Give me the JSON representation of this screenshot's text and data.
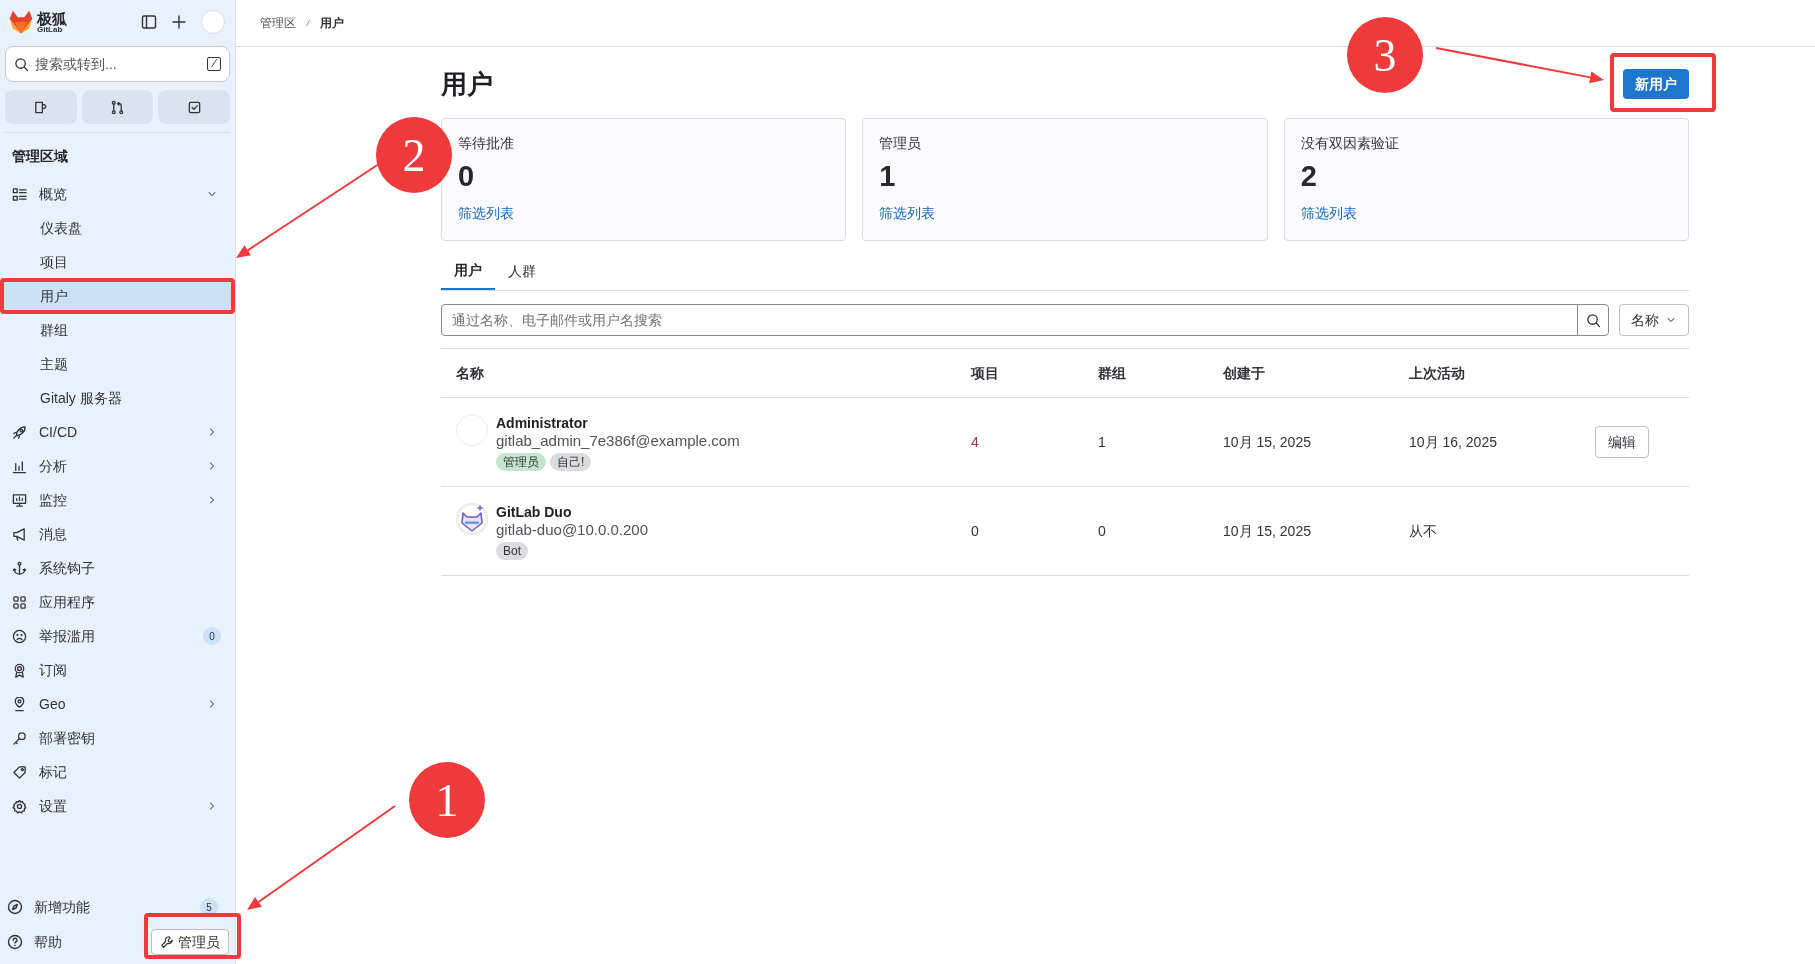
{
  "sidebar": {
    "logo_text": "极狐",
    "logo_sub": "GitLab",
    "search_placeholder": "搜索或转到...",
    "search_shortcut": "/",
    "section_title": "管理区域",
    "items": [
      {
        "label": "概览",
        "selected": false,
        "expanded": true,
        "children": [
          {
            "label": "仪表盘",
            "selected": false
          },
          {
            "label": "项目",
            "selected": false
          },
          {
            "label": "用户",
            "selected": true
          },
          {
            "label": "群组",
            "selected": false
          },
          {
            "label": "主题",
            "selected": false
          },
          {
            "label": "Gitaly 服务器",
            "selected": false
          }
        ]
      },
      {
        "label": "CI/CD",
        "selected": false,
        "expanded": false
      },
      {
        "label": "分析",
        "selected": false,
        "expanded": false
      },
      {
        "label": "监控",
        "selected": false,
        "expanded": false
      },
      {
        "label": "消息",
        "selected": false
      },
      {
        "label": "系统钩子",
        "selected": false
      },
      {
        "label": "应用程序",
        "selected": false
      },
      {
        "label": "举报滥用",
        "selected": false,
        "badge": "0"
      },
      {
        "label": "订阅",
        "selected": false
      },
      {
        "label": "Geo",
        "selected": false,
        "expanded": false
      },
      {
        "label": "部署密钥",
        "selected": false
      },
      {
        "label": "标记",
        "selected": false
      },
      {
        "label": "设置",
        "selected": false,
        "expanded": false
      }
    ],
    "whats_new": {
      "label": "新增功能",
      "badge": "5"
    },
    "help": "帮助",
    "admin_button": "管理员"
  },
  "breadcrumb": [
    "管理区",
    "用户"
  ],
  "page_title": "用户",
  "new_user_button": "新用户",
  "stats": [
    {
      "label": "等待批准",
      "value": "0",
      "link": "筛选列表"
    },
    {
      "label": "管理员",
      "value": "1",
      "link": "筛选列表"
    },
    {
      "label": "没有双因素验证",
      "value": "2",
      "link": "筛选列表"
    }
  ],
  "tabs": [
    {
      "label": "用户",
      "selected": true
    },
    {
      "label": "人群",
      "selected": false
    }
  ],
  "search": {
    "placeholder": "通过名称、电子邮件或用户名搜索"
  },
  "sort": "名称",
  "table": {
    "columns": [
      "名称",
      "项目",
      "群组",
      "创建于",
      "上次活动"
    ],
    "rows": [
      {
        "kind": "human",
        "name": "Administrator",
        "email": "gitlab_admin_7e386f@example.com",
        "tags": [
          {
            "label": "管理员",
            "color": "#c3e6cd"
          },
          {
            "label": "自己!",
            "color": "#dcdcde"
          }
        ],
        "projects": "4",
        "groups": "1",
        "created": "10月 15, 2025",
        "last_activity": "10月 16, 2025",
        "action": "编辑"
      },
      {
        "kind": "bot",
        "name": "GitLab Duo",
        "email": "gitlab-duo@10.0.0.200",
        "tags": [
          {
            "label": "Bot",
            "color": "#dcdcde"
          }
        ],
        "projects": "0",
        "groups": "0",
        "created": "10月 15, 2025",
        "last_activity": "从不"
      }
    ]
  },
  "annotations": [
    {
      "number": "1"
    },
    {
      "number": "2"
    },
    {
      "number": "3"
    }
  ]
}
